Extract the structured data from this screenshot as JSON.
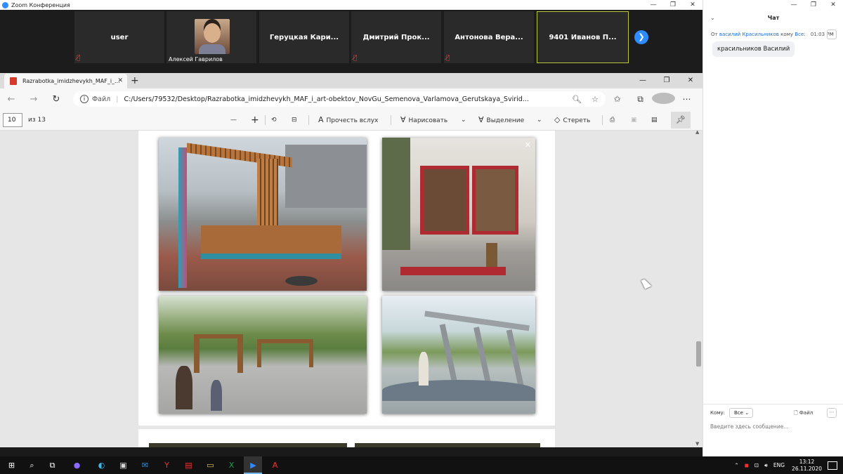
{
  "zoom": {
    "window_title": "Zoom Конференция",
    "participants": [
      {
        "name": "user",
        "muted": true
      },
      {
        "name": "Алексей Гаврилов",
        "muted": false,
        "has_video": true
      },
      {
        "name": "Геруцкая Кари...",
        "muted": false
      },
      {
        "name": "Дмитрий Прок...",
        "muted": true
      },
      {
        "name": "Антонова Вера...",
        "muted": true
      },
      {
        "name": "9401 Иванов П...",
        "muted": false,
        "active_speaker": true
      }
    ],
    "next_icon": "chevron-right-icon"
  },
  "chat": {
    "title": "Чат",
    "message": {
      "from_label": "От",
      "sender": "василий Красильников",
      "to_label": "кому",
      "recipient": "Все:",
      "time": "01:03 PM",
      "text": "красильников Василий"
    },
    "to_field_label": "Кому:",
    "to_value": "Все",
    "file_label": "Файл",
    "input_placeholder": "Введите здесь сообщение..."
  },
  "browser": {
    "tab_title": "Razrabotka_imidzhevykh_MAF_i_...",
    "address_scheme": "Файл",
    "url": "C:/Users/79532/Desktop/Razrabotka_imidzhevykh_MAF_i_art-obektov_NovGu_Semenova_Varlamova_Gerutskaya_Svirid...",
    "pdf_toolbar": {
      "page_current": "10",
      "page_total": "из 13",
      "read_aloud": "Прочесть вслух",
      "draw": "Нарисовать",
      "highlight": "Выделение",
      "erase": "Стереть"
    }
  },
  "taskbar": {
    "language": "ENG",
    "time": "13:12",
    "date": "26.11.2020"
  }
}
